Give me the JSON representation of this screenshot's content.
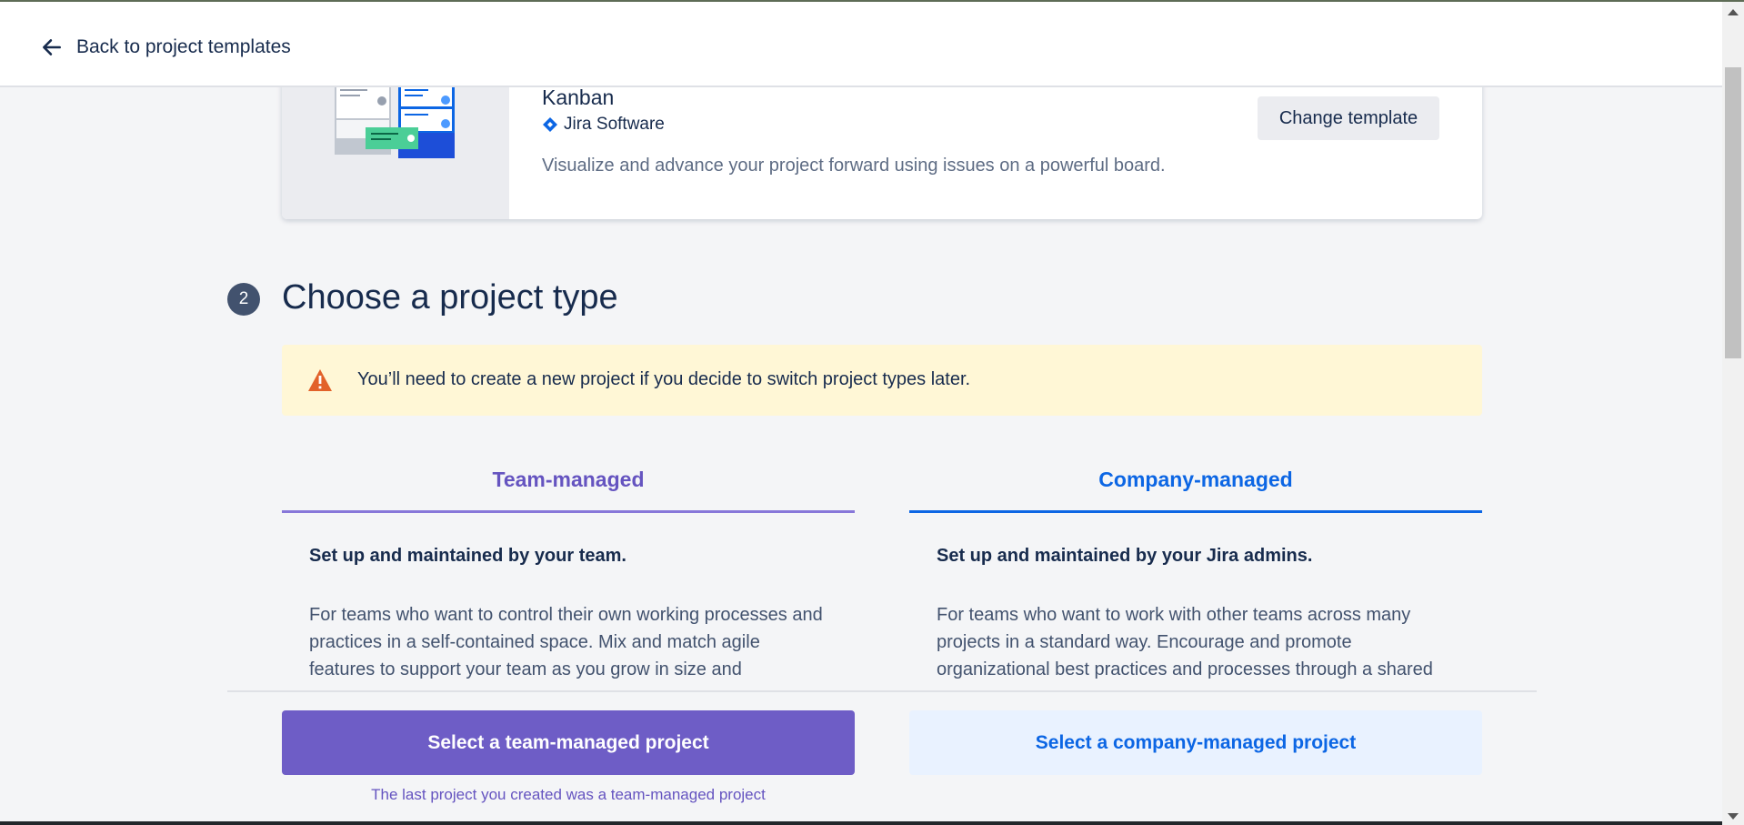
{
  "header": {
    "back_label": "Back to project templates"
  },
  "template": {
    "name": "Kanban",
    "product": "Jira Software",
    "description": "Visualize and advance your project forward using issues on a powerful board.",
    "change_label": "Change template"
  },
  "section": {
    "step": "2",
    "title": "Choose a project type"
  },
  "warning": {
    "text": "You’ll need to create a new project if you decide to switch project types later."
  },
  "team_managed": {
    "tab": "Team-managed",
    "heading": "Set up and maintained by your team.",
    "body": "For teams who want to control their own working processes and practices in a self-contained space. Mix and match agile features to support your team as you grow in size and complexity.",
    "button": "Select a team-managed project",
    "note": "The last project you created was a team-managed project"
  },
  "company_managed": {
    "tab": "Company-managed",
    "heading": "Set up and maintained by your Jira admins.",
    "body": "For teams who want to work with other teams across many projects in a standard way. Encourage and promote organizational best practices and processes through a shared configuration.",
    "button": "Select a company-managed project"
  },
  "colors": {
    "team_accent": "#6e5dc6",
    "company_accent": "#0c66e4",
    "warning_bg": "#fff7d6",
    "warning_icon": "#e2622a"
  }
}
